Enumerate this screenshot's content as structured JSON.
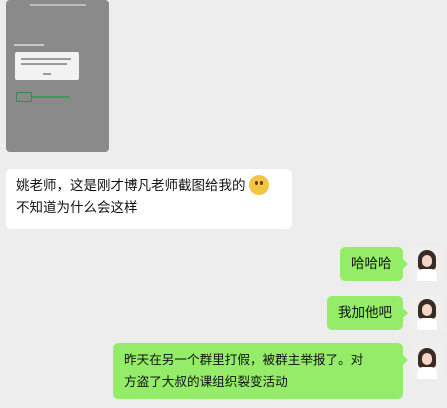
{
  "messages": [
    {
      "line1": "姚老师，这是刚才博凡老师截图给我的",
      "line2": "不知道为什么会这样",
      "emoji": "confused-emoji"
    },
    {
      "text": "哈哈哈"
    },
    {
      "text": "我加他吧"
    },
    {
      "line1": "昨天在另一个群里打假，被群主举报了。对",
      "line2": "方盗了大叔的课组织裂变活动"
    }
  ],
  "colors": {
    "bg": "#ededed",
    "sent": "#95ec69",
    "received": "#ffffff"
  }
}
